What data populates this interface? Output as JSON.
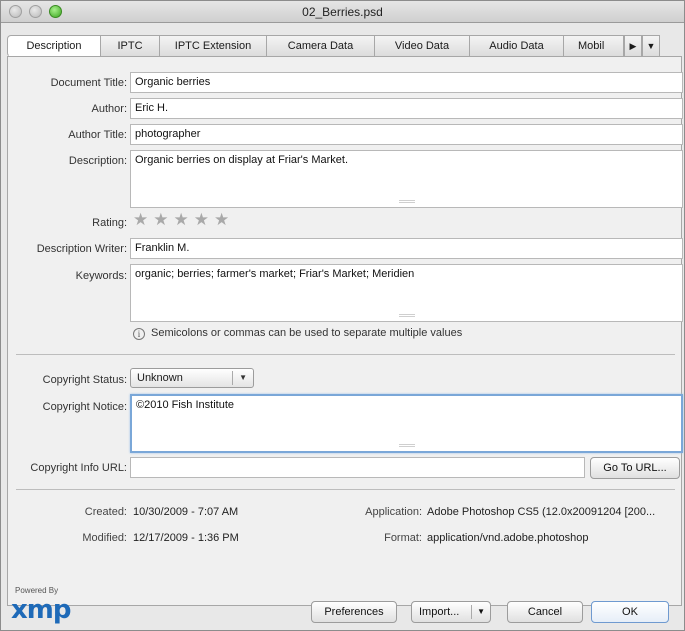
{
  "window": {
    "title": "02_Berries.psd"
  },
  "tabs": [
    {
      "label": "Description"
    },
    {
      "label": "IPTC"
    },
    {
      "label": "IPTC Extension"
    },
    {
      "label": "Camera Data"
    },
    {
      "label": "Video Data"
    },
    {
      "label": "Audio Data"
    },
    {
      "label": "Mobil"
    }
  ],
  "form": {
    "document_title": {
      "label": "Document Title:",
      "value": "Organic berries"
    },
    "author": {
      "label": "Author:",
      "value": "Eric H."
    },
    "author_title": {
      "label": "Author Title:",
      "value": "photographer"
    },
    "description": {
      "label": "Description:",
      "value": "Organic berries on display at Friar's Market."
    },
    "rating": {
      "label": "Rating:",
      "stars_total": 5,
      "stars_filled": 0
    },
    "description_writer": {
      "label": "Description Writer:",
      "value": "Franklin M."
    },
    "keywords": {
      "label": "Keywords:",
      "value": "organic; berries; farmer's market; Friar's Market; Meridien"
    },
    "hint": "Semicolons or commas can be used to separate multiple values",
    "copyright_status": {
      "label": "Copyright Status:",
      "value": "Unknown"
    },
    "copyright_notice": {
      "label": "Copyright Notice:",
      "value": "©2010 Fish Institute"
    },
    "copyright_url": {
      "label": "Copyright Info URL:",
      "value": "",
      "button": "Go To URL..."
    }
  },
  "meta": {
    "created_label": "Created:",
    "created_value": "10/30/2009 - 7:07 AM",
    "modified_label": "Modified:",
    "modified_value": "12/17/2009 - 1:36 PM",
    "application_label": "Application:",
    "application_value": "Adobe Photoshop CS5 (12.0x20091204 [200...",
    "format_label": "Format:",
    "format_value": "application/vnd.adobe.photoshop"
  },
  "footer": {
    "powered_by": "Powered By",
    "logo": "xmp",
    "preferences": "Preferences",
    "import": "Import...",
    "cancel": "Cancel",
    "ok": "OK"
  },
  "colors": {
    "accent": "#7aa7d8",
    "xmp_blue": "#1e6ab8",
    "zoom_green": "#3aa51e"
  }
}
